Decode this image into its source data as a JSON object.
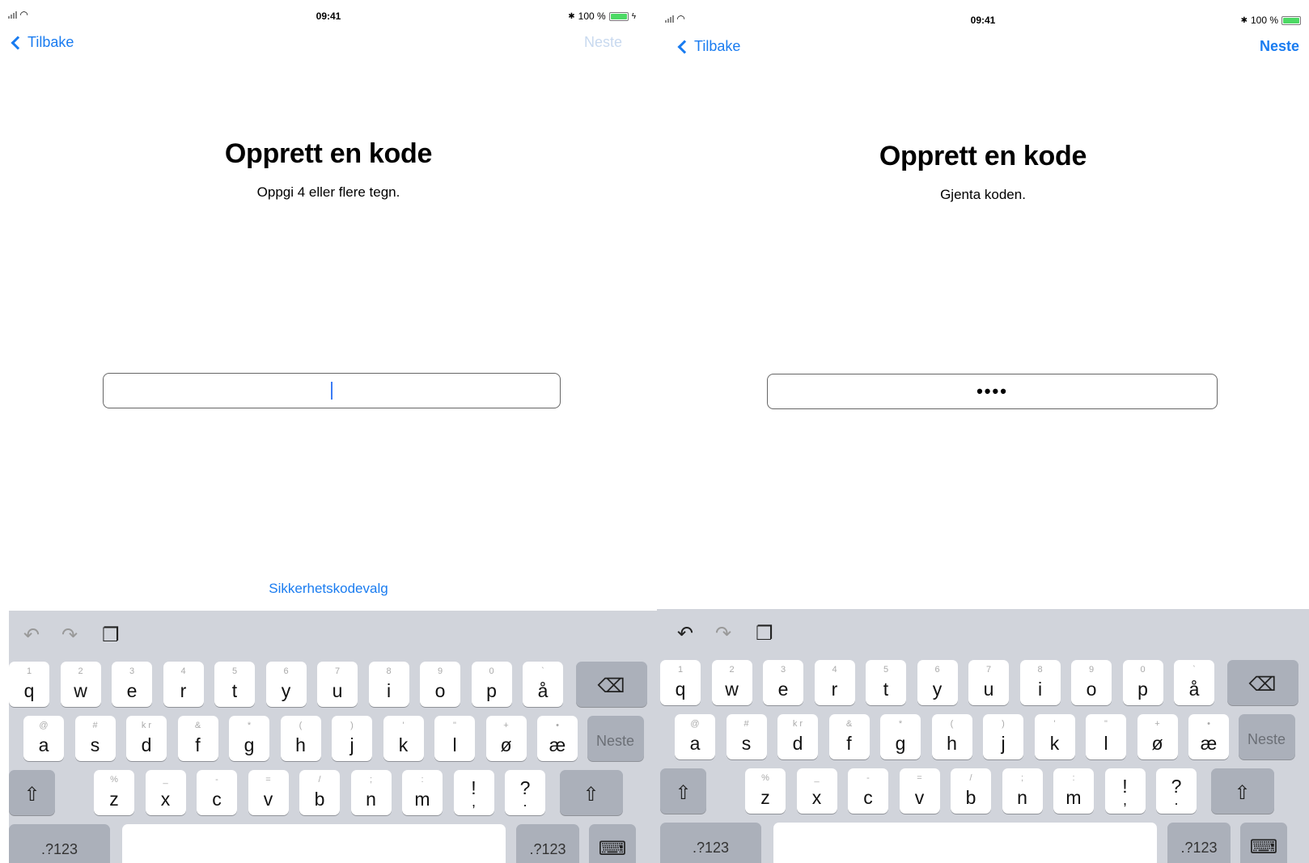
{
  "status": {
    "time": "09:41",
    "battery": "100 %",
    "bluetooth": "✱",
    "wifi": "wifi-icon",
    "battery_level": 1.0
  },
  "screens": [
    {
      "back": "Tilbake",
      "next": "Neste",
      "next_enabled": false,
      "title": "Opprett en kode",
      "subtitle": "Oppgi 4 eller flere tegn.",
      "input_value": "",
      "options_link": "Sikkerhetskodevalg"
    },
    {
      "back": "Tilbake",
      "next": "Neste",
      "next_enabled": true,
      "title": "Opprett en kode",
      "subtitle": "Gjenta koden.",
      "input_value": "••••"
    }
  ],
  "keyboard": {
    "toolbar": {
      "undo": "undo-icon",
      "redo": "redo-icon",
      "paste": "paste-icon"
    },
    "row1": [
      {
        "main": "q",
        "alt": "1"
      },
      {
        "main": "w",
        "alt": "2"
      },
      {
        "main": "e",
        "alt": "3"
      },
      {
        "main": "r",
        "alt": "4"
      },
      {
        "main": "t",
        "alt": "5"
      },
      {
        "main": "y",
        "alt": "6"
      },
      {
        "main": "u",
        "alt": "7"
      },
      {
        "main": "i",
        "alt": "8"
      },
      {
        "main": "o",
        "alt": "9"
      },
      {
        "main": "p",
        "alt": "0"
      },
      {
        "main": "å",
        "alt": "`"
      }
    ],
    "row2": [
      {
        "main": "a",
        "alt": "@"
      },
      {
        "main": "s",
        "alt": "#"
      },
      {
        "main": "d",
        "alt": "k r"
      },
      {
        "main": "f",
        "alt": "&"
      },
      {
        "main": "g",
        "alt": "*"
      },
      {
        "main": "h",
        "alt": "("
      },
      {
        "main": "j",
        "alt": ")"
      },
      {
        "main": "k",
        "alt": "'"
      },
      {
        "main": "l",
        "alt": "\""
      },
      {
        "main": "ø",
        "alt": "+"
      },
      {
        "main": "æ",
        "alt": "•"
      }
    ],
    "row3": [
      {
        "main": "z",
        "alt": "%"
      },
      {
        "main": "x",
        "alt": "_"
      },
      {
        "main": "c",
        "alt": "-"
      },
      {
        "main": "v",
        "alt": "="
      },
      {
        "main": "b",
        "alt": "/"
      },
      {
        "main": "n",
        "alt": ";"
      },
      {
        "main": "m",
        "alt": ":"
      },
      {
        "main": "!",
        "alt": ""
      },
      {
        "main": "?",
        "alt": ""
      }
    ],
    "row3_sub": {
      "!": ",",
      "?": "."
    },
    "return_label": "Neste",
    "numbers_label": ".?123",
    "delete_icon": "delete-icon",
    "shift_icon": "shift-icon",
    "hide_icon": "keyboard-hide-icon"
  }
}
